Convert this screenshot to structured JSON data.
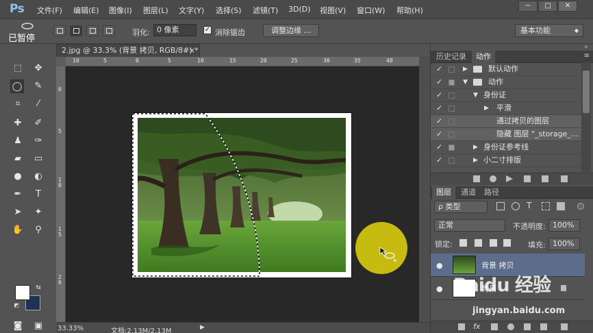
{
  "app": {
    "logo": "Ps",
    "menus": [
      "文件(F)",
      "编辑(E)",
      "图像(I)",
      "图层(L)",
      "文字(Y)",
      "选择(S)",
      "滤镜(T)",
      "3D(D)",
      "视图(V)",
      "窗口(W)",
      "帮助(H)"
    ],
    "window_buttons": [
      "−",
      "□",
      "✕"
    ]
  },
  "options": {
    "tool_name": "已暂停",
    "feather_label": "羽化:",
    "feather_value": "0 像素",
    "antialias_label": "消除锯齿",
    "refine_edge": "调整边缘 ...",
    "workspace": "基本功能"
  },
  "document": {
    "tab_title": "2.jpg @ 33.3% (背景 拷贝, RGB/8#) *",
    "tab_close": "×",
    "zoom": "33.33%",
    "doc_info": "文档:2.13M/2.13M",
    "status_arrow": "▶",
    "ruler_top_labels": [
      "10",
      "5",
      "0",
      "5",
      "10",
      "15",
      "20",
      "25",
      "30",
      "35",
      "40"
    ],
    "ruler_left_labels": [
      "0",
      "5",
      "1 0",
      "1 5",
      "2 0"
    ]
  },
  "colors": {
    "foreground": "#ffffff",
    "background": "#1e3253",
    "cursor_highlight": "#c7ba10"
  },
  "actions_panel": {
    "tabs": [
      "历史记录",
      "动作"
    ],
    "collapse_icon": "»",
    "menu_icon": "≡",
    "rows": [
      {
        "label": "默认动作",
        "checked": "✓",
        "arrow": "▶"
      },
      {
        "label": "动作",
        "checked": "✓",
        "arrow": "▼"
      },
      {
        "label": "身份证",
        "checked": "✓",
        "arrow": "▼"
      },
      {
        "label": "平滑",
        "checked": "✓",
        "arrow": "▶"
      },
      {
        "label": "通过拷贝的图层",
        "checked": "✓",
        "arrow": ""
      },
      {
        "label": "隐藏 图层 \"_storage_...",
        "checked": "✓",
        "arrow": ""
      },
      {
        "label": "身份证参考线",
        "checked": "✓",
        "arrow": "▶"
      },
      {
        "label": "小二寸排版",
        "checked": "✓",
        "arrow": "▶"
      }
    ]
  },
  "layers_panel": {
    "tabs": [
      "图层",
      "通道",
      "路径"
    ],
    "filter_label": "ρ 类型",
    "blend_mode": "正常",
    "opacity_label": "不透明度:",
    "opacity_value": "100%",
    "lock_label": "锁定:",
    "fill_label": "填充:",
    "fill_value": "100%",
    "layers": [
      {
        "name": "背景 拷贝",
        "visible": "●"
      },
      {
        "name": "背景",
        "visible": "●"
      }
    ]
  },
  "watermark": {
    "logo": "Baidu 经验",
    "url": "jingyan.baidu.com"
  }
}
